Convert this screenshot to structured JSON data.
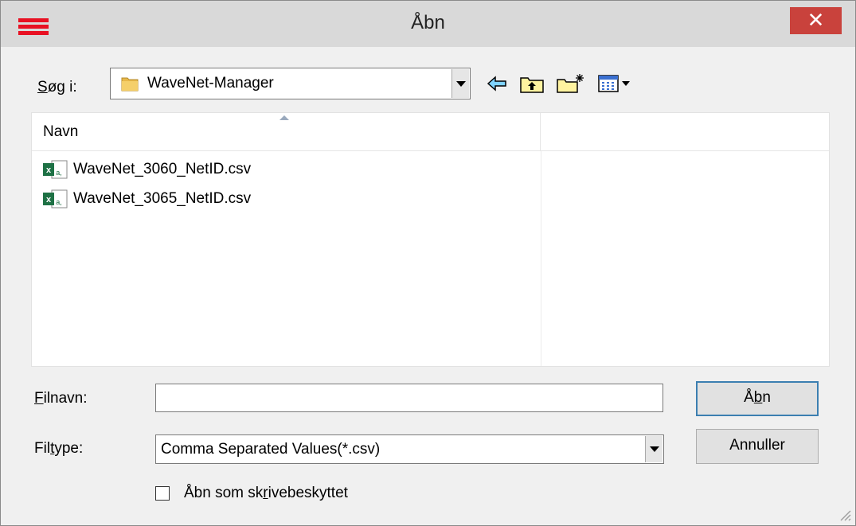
{
  "window": {
    "title": "Åbn",
    "close_glyph": "✕"
  },
  "lookin": {
    "label_mnemonic": "S",
    "label_rest": "øg i:",
    "value": "WaveNet-Manager",
    "folder_icon": "folder-icon"
  },
  "toolbar": {
    "icons": [
      "back-arrow-icon",
      "up-folder-icon",
      "new-folder-icon",
      "view-menu-icon"
    ]
  },
  "file_list": {
    "columns": [
      "Navn"
    ],
    "files": [
      {
        "name": "WaveNet_3060_NetID.csv",
        "icon": "excel-csv-file-icon"
      },
      {
        "name": "WaveNet_3065_NetID.csv",
        "icon": "excel-csv-file-icon"
      }
    ]
  },
  "filename": {
    "label_mnemonic": "F",
    "label_rest": "ilnavn:",
    "value": "",
    "placeholder": ""
  },
  "filetype": {
    "label_pre": "Fil",
    "label_mnemonic": "t",
    "label_rest": "ype:",
    "value": "Comma Separated Values(*.csv)"
  },
  "buttons": {
    "open_pre": "Å",
    "open_mnemonic": "b",
    "open_rest": "n",
    "cancel": "Annuller"
  },
  "readonly": {
    "label_pre": "Åbn som sk",
    "label_mnemonic": "r",
    "label_rest": "ivebeskyttet",
    "checked": false
  },
  "colors": {
    "close_bg": "#c9423c",
    "app_icon": "#e81123",
    "default_button_border": "#3c7fb1"
  }
}
